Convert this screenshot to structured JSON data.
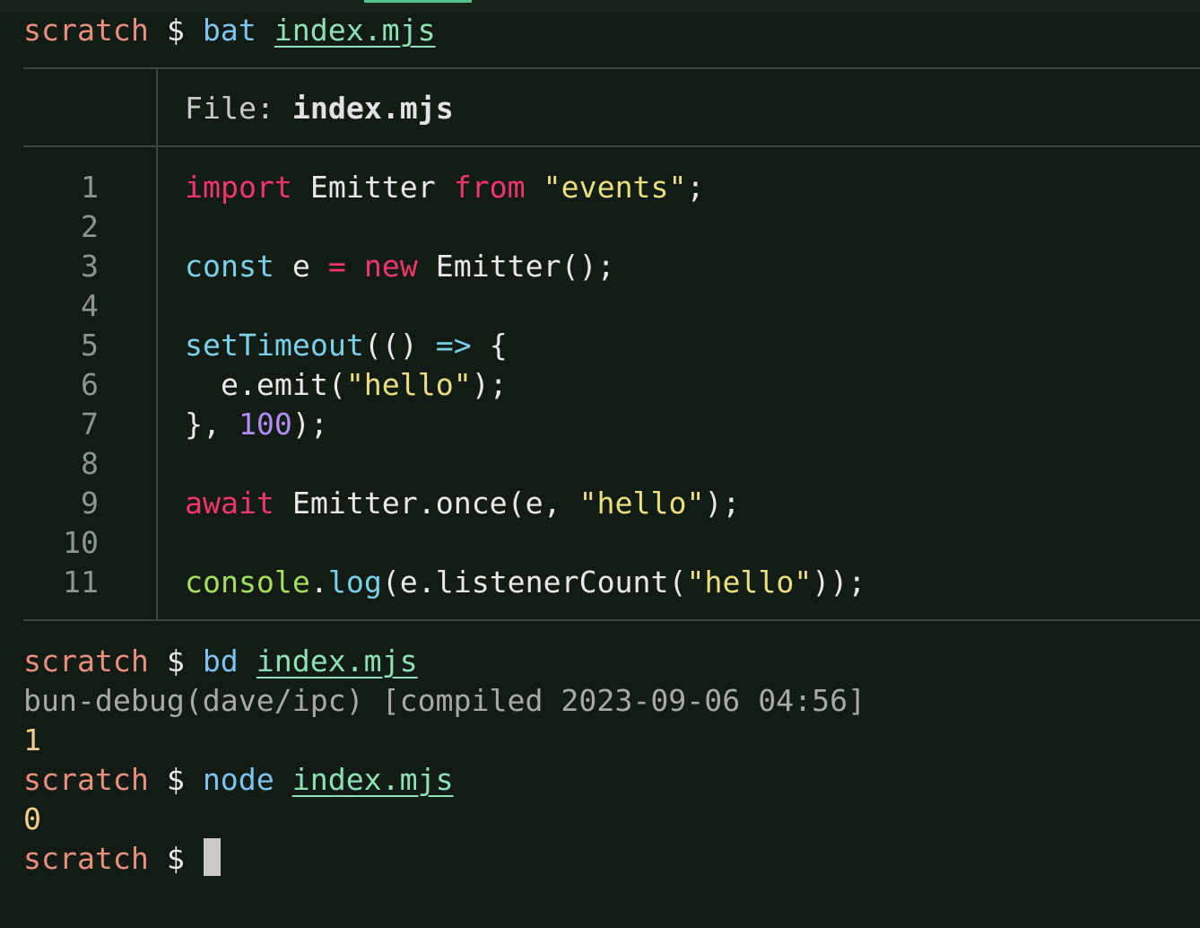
{
  "prompt": "scratch",
  "dollar": "$",
  "session": [
    {
      "cmd": "bat",
      "arg": "index.mjs"
    },
    {
      "cmd": "bd",
      "arg": "index.mjs",
      "info": "bun-debug(dave/ipc) [compiled 2023-09-06 04:56]",
      "output": "1"
    },
    {
      "cmd": "node",
      "arg": "index.mjs",
      "output": "0"
    }
  ],
  "bat": {
    "file_label": "File: ",
    "file_name": "index.mjs",
    "line_numbers": [
      "1",
      "2",
      "3",
      "4",
      "5",
      "6",
      "7",
      "8",
      "9",
      "10",
      "11"
    ],
    "code": {
      "l1": {
        "t1": "import",
        "t2": " Emitter ",
        "t3": "from",
        "t4": " ",
        "t5": "\"events\"",
        "t6": ";"
      },
      "l3": {
        "t1": "const",
        "t2": " e ",
        "t3": "=",
        "t4": " ",
        "t5": "new",
        "t6": " Emitter();"
      },
      "l5": {
        "t1": "setTimeout",
        "t2": "(() ",
        "t3": "=>",
        "t4": " {"
      },
      "l6": {
        "t1": "  e.emit(",
        "t2": "\"hello\"",
        "t3": ");"
      },
      "l7": {
        "t1": "}, ",
        "t2": "100",
        "t3": ");"
      },
      "l9": {
        "t1": "await",
        "t2": " Emitter.once(e, ",
        "t3": "\"hello\"",
        "t4": ");"
      },
      "l11": {
        "t1": "console",
        "t2": ".",
        "t3": "log",
        "t4": "(e.listenerCount(",
        "t5": "\"hello\"",
        "t6": "));"
      }
    }
  },
  "colors": {
    "background": "#121b14",
    "prompt": "#e88f7e",
    "command": "#7cc4f2",
    "argument": "#8ee0b6",
    "keyword": "#f0366a",
    "string": "#e9df7e",
    "number": "#b08cf6",
    "output": "#f0cf8a"
  }
}
